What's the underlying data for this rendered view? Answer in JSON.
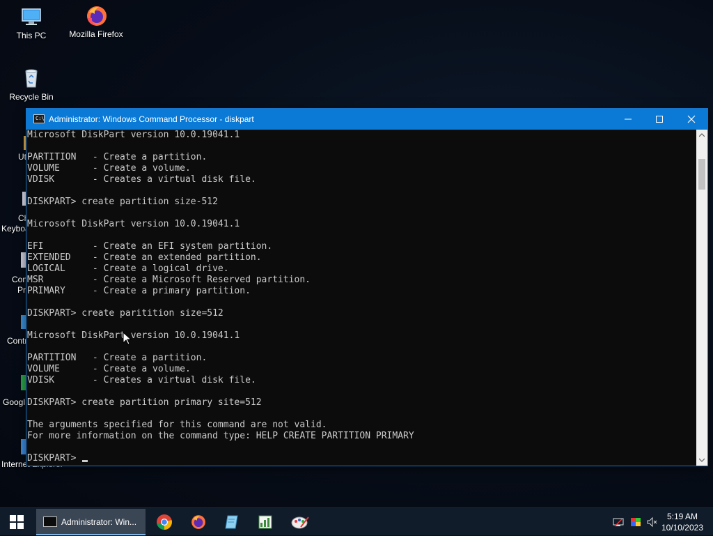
{
  "desktop": {
    "icons": [
      {
        "label": "This PC"
      },
      {
        "label": "Mozilla Firefox"
      },
      {
        "label": "Recycle Bin"
      }
    ],
    "partial_labels": [
      "Ut",
      "Ch",
      "Keyboa",
      "Con",
      "Pr",
      "Contr",
      "Googl",
      "Internet Explorer"
    ]
  },
  "window": {
    "title": "Administrator: Windows Command Processor - diskpart",
    "console_lines": [
      "Microsoft DiskPart version 10.0.19041.1",
      "",
      "PARTITION   - Create a partition.",
      "VOLUME      - Create a volume.",
      "VDISK       - Creates a virtual disk file.",
      "",
      "DISKPART> create partition size-512",
      "",
      "Microsoft DiskPart version 10.0.19041.1",
      "",
      "EFI         - Create an EFI system partition.",
      "EXTENDED    - Create an extended partition.",
      "LOGICAL     - Create a logical drive.",
      "MSR         - Create a Microsoft Reserved partition.",
      "PRIMARY     - Create a primary partition.",
      "",
      "DISKPART> create paritition size=512",
      "",
      "Microsoft DiskPart version 10.0.19041.1",
      "",
      "PARTITION   - Create a partition.",
      "VOLUME      - Create a volume.",
      "VDISK       - Creates a virtual disk file.",
      "",
      "DISKPART> create partition primary site=512",
      "",
      "The arguments specified for this command are not valid.",
      "For more information on the command type: HELP CREATE PARTITION PRIMARY",
      "",
      "DISKPART> "
    ]
  },
  "taskbar": {
    "active_task_label": "Administrator: Win...",
    "pinned": [
      "chrome-icon",
      "firefox-icon",
      "notepad-icon",
      "spreadsheet-icon",
      "paint-icon"
    ],
    "clock_time": "5:19 AM",
    "clock_date": "10/10/2023"
  },
  "colors": {
    "titlebar": "#0a7ad6",
    "console_bg": "#0c0c0c",
    "console_fg": "#cccccc",
    "taskbar": "#101c2a"
  }
}
